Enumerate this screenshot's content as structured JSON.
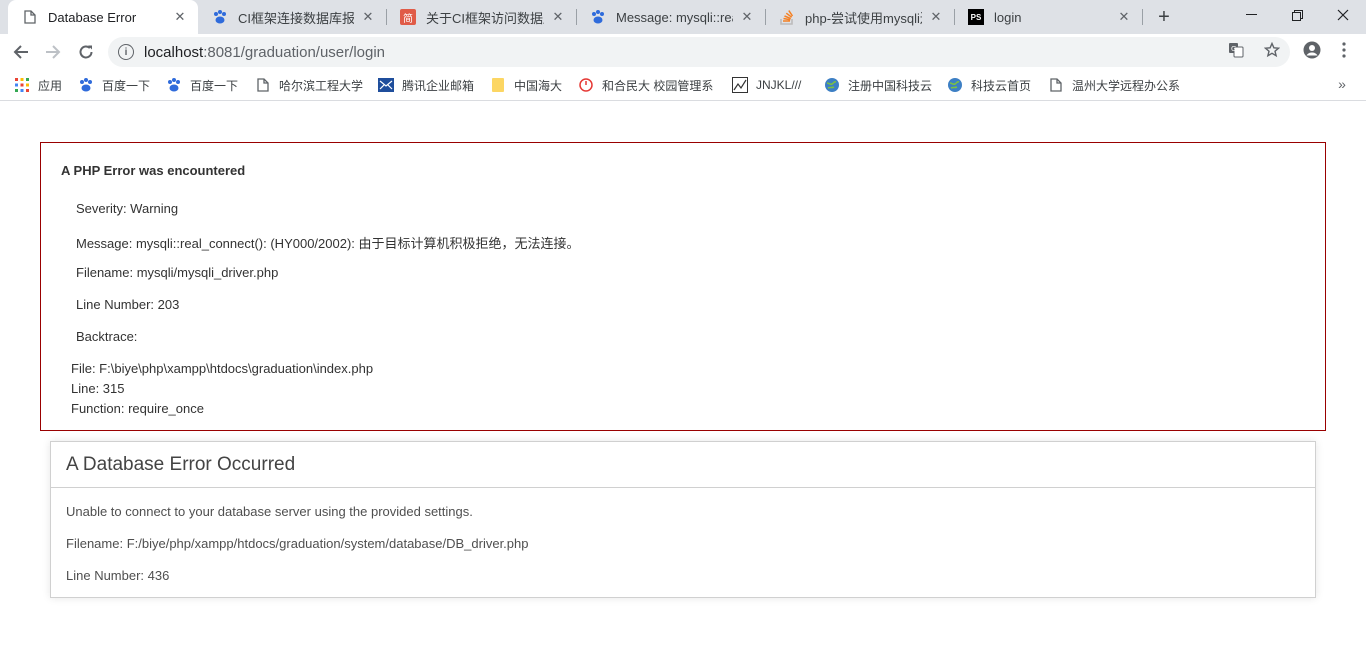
{
  "tabs": [
    {
      "title": "Database Error",
      "icon": "page-icon",
      "active": true
    },
    {
      "title": "CI框架连接数据库报错",
      "icon": "baidu-paw-icon"
    },
    {
      "title": "关于CI框架访问数据库",
      "icon": "jianshu-icon",
      "icon_text": "简"
    },
    {
      "title": "Message: mysqli::real_",
      "icon": "baidu-paw-icon"
    },
    {
      "title": "php-尝试使用mysqli连",
      "icon": "stackoverflow-icon"
    },
    {
      "title": "login",
      "icon": "phpstorm-icon",
      "icon_text": "PS"
    }
  ],
  "omnibox": {
    "host": "localhost",
    "path": ":8081/graduation/user/login"
  },
  "bookmarks": [
    {
      "label": "应用",
      "icon": "apps-grid-icon"
    },
    {
      "label": "百度一下",
      "icon": "baidu-paw-icon"
    },
    {
      "label": "百度一下",
      "icon": "baidu-paw-icon"
    },
    {
      "label": "哈尔滨工程大学",
      "icon": "page-icon"
    },
    {
      "label": "腾讯企业邮箱",
      "icon": "tencent-mail-icon"
    },
    {
      "label": "中国海大",
      "icon": "folder-icon"
    },
    {
      "label": "和合民大 校园管理系",
      "icon": "power-icon"
    },
    {
      "label": "JNJKL///",
      "icon": "chart-icon"
    },
    {
      "label": "注册中国科技云",
      "icon": "globe-icon"
    },
    {
      "label": "科技云首页",
      "icon": "globe-icon"
    },
    {
      "label": "温州大学远程办公系",
      "icon": "page-icon"
    }
  ],
  "php_error": {
    "heading": "A PHP Error was encountered",
    "severity": "Severity: Warning",
    "message": "Message: mysqli::real_connect(): (HY000/2002): 由于目标计算机积极拒绝，无法连接。",
    "filename": "Filename: mysqli/mysqli_driver.php",
    "line_number": "Line Number: 203",
    "backtrace": "Backtrace:",
    "bt_file": "File: F:\\biye\\php\\xampp\\htdocs\\graduation\\index.php",
    "bt_line": "Line: 315",
    "bt_function": "Function: require_once"
  },
  "db_error": {
    "heading": "A Database Error Occurred",
    "message": "Unable to connect to your database server using the provided settings.",
    "filename": "Filename: F:/biye/php/xampp/htdocs/graduation/system/database/DB_driver.php",
    "line_number": "Line Number: 436"
  },
  "colors": {
    "php_border": "#990000",
    "tabstrip": "#dee1e6"
  }
}
